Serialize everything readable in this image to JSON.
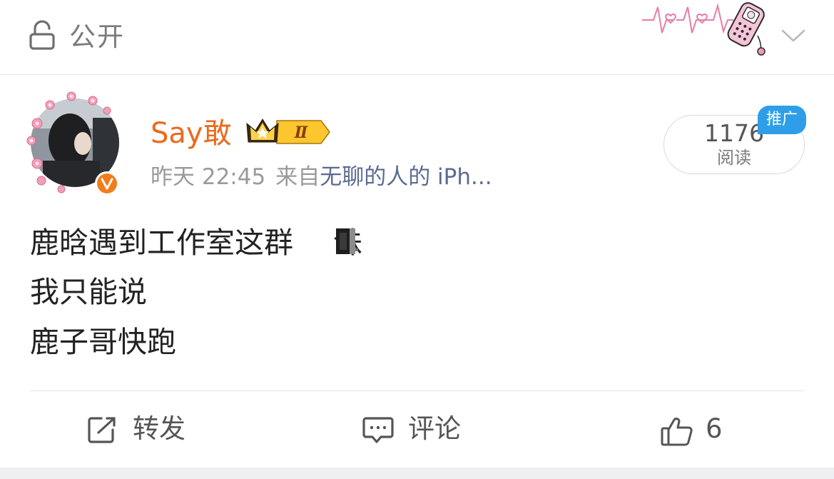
{
  "header": {
    "visibility_label": "公开",
    "lock_icon": "lock-open-icon",
    "expand_icon": "chevron-down-icon",
    "decoration_icon": "heartbeat-flip-phone-sticker"
  },
  "post": {
    "author": {
      "name": "Say敢",
      "verified_icon": "verified-v-icon",
      "vip_level": "Ⅱ"
    },
    "time": "昨天 22:45",
    "source_prefix": "来自",
    "source_device": "无聊的人的 iPh...",
    "reads": {
      "count": "1176",
      "label": "阅读"
    },
    "promo_tag": "推广",
    "content_lines": [
      "鹿晗遇到工作室这群",
      "我只能说",
      "鹿子哥快跑"
    ],
    "content_line1_tail": "诛"
  },
  "actions": {
    "repost": {
      "label": "转发",
      "icon": "repost-icon"
    },
    "comment": {
      "label": "评论",
      "icon": "comment-icon"
    },
    "like": {
      "count": "6",
      "icon": "thumbs-up-icon"
    }
  },
  "colors": {
    "accent": "#ea6a1c",
    "link": "#5b6b91",
    "promo": "#2f9ee8"
  }
}
